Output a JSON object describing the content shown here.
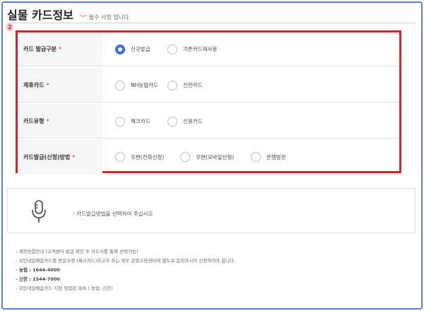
{
  "header": {
    "title": "실물 카드정보",
    "required_mark": "\"*\"",
    "required_text": "필수 사항 입니다."
  },
  "step_badge": "②",
  "form": {
    "rows": [
      {
        "label": "카드 발급구분",
        "required": "*",
        "options": [
          {
            "label": "신규발급",
            "checked": true
          },
          {
            "label": "기존카드재사용",
            "checked": false
          }
        ]
      },
      {
        "label": "제휴카드",
        "required": "*",
        "options": [
          {
            "label": "NH농협카드",
            "checked": false
          },
          {
            "label": "신한카드",
            "checked": false
          }
        ]
      },
      {
        "label": "카드유형",
        "required": "*",
        "options": [
          {
            "label": "체크카드",
            "checked": false
          },
          {
            "label": "신용카드",
            "checked": false
          }
        ]
      },
      {
        "label": "카드발급(신청)방법",
        "required": "*",
        "options": [
          {
            "label": "우편(전화신청)",
            "checked": false
          },
          {
            "label": "우편(모바일신청)",
            "checked": false
          },
          {
            "label": "은행방문",
            "checked": false
          }
        ]
      }
    ]
  },
  "info": {
    "icon": "microphone-icon",
    "text": "- 카드발급방법을 선택하여 주십시오"
  },
  "notes": [
    "- 계좌연결안내 (고객센터 발급 확인 후 카드사를 통해 선택가능)",
    "- 국민내일배움카드를 방문수령 (체크카드)하고자 하는 경우 관할고용센터에 별도로 문의하시어 신청하여야 합니다.",
    "- 농협 : 1644-4000",
    "- 신한 : 1544-7000",
    "- 국민내일배움카드 지점 영업점 목록 ( 농협, 신한)"
  ],
  "colors": {
    "accent": "#3b6fe0",
    "highlight_box": "#d6232a",
    "required": "#e8612c"
  }
}
